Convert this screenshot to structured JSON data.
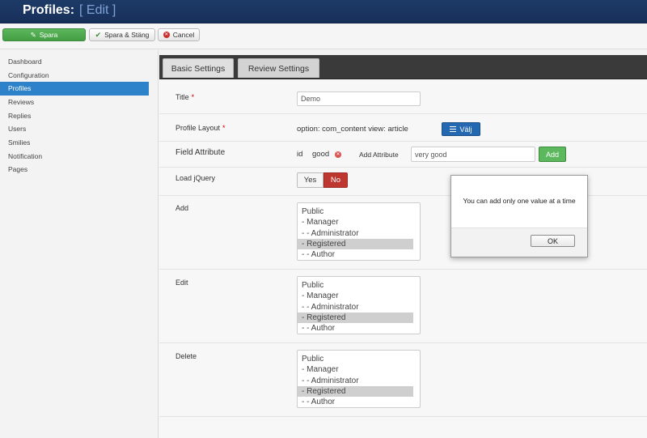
{
  "header": {
    "title": "Profiles:",
    "subtitle": "[ Edit ]"
  },
  "toolbar": {
    "save_label": "Spara",
    "save_close_label": "Spara & Stäng",
    "cancel_label": "Cancel"
  },
  "sidebar": {
    "items": [
      {
        "label": "Dashboard"
      },
      {
        "label": "Configuration"
      },
      {
        "label": "Profiles",
        "active": true
      },
      {
        "label": "Reviews"
      },
      {
        "label": "Replies"
      },
      {
        "label": "Users"
      },
      {
        "label": "Smilies"
      },
      {
        "label": "Notification"
      },
      {
        "label": "Pages"
      }
    ]
  },
  "tabs": [
    {
      "label": "Basic Settings",
      "active": true
    },
    {
      "label": "Review Settings"
    }
  ],
  "form": {
    "title": {
      "label": "Title",
      "required_mark": "*",
      "value": "Demo"
    },
    "profile_layout": {
      "label": "Profile Layout",
      "required_mark": "*",
      "value": "option: com_content view: article",
      "button_label": "Välj"
    },
    "field_attribute": {
      "label": "Field Attribute",
      "key": "id",
      "value": "good",
      "add_label": "Add Attribute",
      "input_value": "very good",
      "add_button": "Add"
    },
    "load_jquery": {
      "label": "Load jQuery",
      "yes": "Yes",
      "no": "No",
      "selected": "No"
    },
    "add": {
      "label": "Add",
      "options": [
        "Public",
        "- Manager",
        "- - Administrator",
        "- Registered",
        "- - Author"
      ],
      "selected": "- Registered"
    },
    "edit": {
      "label": "Edit",
      "options": [
        "Public",
        "- Manager",
        "- - Administrator",
        "- Registered",
        "- - Author"
      ],
      "selected": "- Registered"
    },
    "delete": {
      "label": "Delete",
      "options": [
        "Public",
        "- Manager",
        "- - Administrator",
        "- Registered",
        "- - Author"
      ],
      "selected": "- Registered"
    }
  },
  "dialog": {
    "message": "You can add only one value at a time",
    "ok_label": "OK"
  },
  "colors": {
    "accent": "#2e82c9",
    "header": "#1d3a66",
    "success": "#5cb85c",
    "danger": "#bd362f"
  }
}
